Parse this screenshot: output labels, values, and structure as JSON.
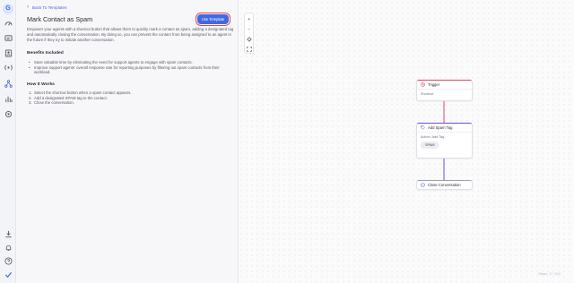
{
  "rail": {
    "avatar_letter": "G",
    "icons": [
      "dashboard-icon",
      "inbox-icon",
      "contacts-icon",
      "broadcast-icon",
      "workflows-icon",
      "reports-icon",
      "settings-icon",
      "download-icon",
      "notifications-icon",
      "help-icon",
      "check-icon"
    ]
  },
  "panel": {
    "back_label": "Back To Templates",
    "title": "Mark Contact as Spam",
    "use_button": "Use Template",
    "description": "Empower your agents with a shortcut button that allows them to quickly mark a contact as spam, adding a designated tag and automatically closing the conversation. By doing so, you can prevent the contact from being assigned to an agent in the future if they try to initiate another conversation.",
    "benefits_heading": "Benefits Included",
    "benefits": [
      "Save valuable time by eliminating the need for support agents to engage with spam contacts.",
      "Improve support agents' overall response rate for reporting purposes by filtering out spam contacts from their workload."
    ],
    "how_heading": "How It Works",
    "steps": [
      "Select the shortcut button when a spam contact appears.",
      "Add a designated SPAM tag to the contact.",
      "Close the conversation."
    ]
  },
  "canvas": {
    "tools": [
      "zoom-in-icon",
      "zoom-out-icon",
      "center-icon",
      "fit-icon"
    ],
    "nodes": {
      "trigger": {
        "title": "Trigger",
        "subtitle": "Shortcut"
      },
      "action": {
        "title": "Add Spam Tag",
        "subtitle": "Action: Add Tag",
        "tag": "SPAM"
      },
      "close": {
        "title": "Close Conversation"
      }
    },
    "zoom_text": "Steps: 3 / 100"
  },
  "colors": {
    "accent": "#4169e1",
    "trigger": "#e2445c",
    "action": "#6a4fd8"
  }
}
